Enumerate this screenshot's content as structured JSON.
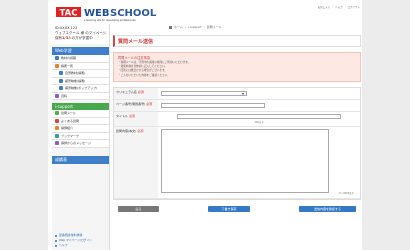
{
  "brand": {
    "school_name": "TAC",
    "product": "WEB SCHOOL",
    "tagline": "a learning site for developing professionals."
  },
  "header": {
    "links": [
      "お気に入り",
      "ヘルプ",
      "ログアウト"
    ]
  },
  "user": {
    "id": "ID:XXXX 122",
    "name": "ウェブスクール 様 のマイページ",
    "points_prefix": "保有",
    "points_value": "1/3",
    "points_suffix": "人の方が学習中"
  },
  "nav": {
    "webschool_head": "Web学習",
    "webschool_items": [
      {
        "label": "教材の視聴",
        "icon": "play-icon"
      },
      {
        "label": "講義一覧",
        "icon": "list-icon"
      },
      {
        "label": "自習教材(講義)",
        "icon": "book-icon"
      },
      {
        "label": "補習映像(講義)",
        "icon": "video-icon"
      },
      {
        "label": "補習映像(ポップアップ)",
        "icon": "popup-icon"
      },
      {
        "label": "資料",
        "icon": "document-icon"
      }
    ],
    "support_head": "i-support",
    "support_items": [
      {
        "label": "質問メール",
        "icon": "mail-icon"
      },
      {
        "label": "よくある質問",
        "icon": "question-icon"
      },
      {
        "label": "講師紹介",
        "icon": "teacher-icon"
      },
      {
        "label": "ブックマーク",
        "icon": "bookmark-icon"
      },
      {
        "label": "講師からのメッセージ",
        "icon": "message-icon"
      }
    ],
    "results_head": "成績表"
  },
  "footer_links": [
    "受講相談/無料体験",
    "Web マイページ/ログイン",
    "ヘルプ"
  ],
  "breadcrumb": [
    "ホーム",
    "i-support",
    "質問メール"
  ],
  "page_title": "質問メール送信",
  "notice": {
    "title": "質問メールの注意事項",
    "lines": [
      "・質問メールは、学習中の講座の質問にご利用いただけます。",
      "・質問内容を具体的に記入してください。",
      "・回答には数日かかる場合がございます。",
      "・ご入力いただいた内容をご確認ください。"
    ]
  },
  "form": {
    "course_label": "カリキュラム名",
    "course_required": "必須",
    "page_label": "ページ番号(問題番号)",
    "page_required": "必須",
    "title_label": "タイトル",
    "title_required": "必須",
    "title_hint": "400文字",
    "body_label": "質問内容(本文)",
    "body_required": "必須",
    "char_count": "0 / 2000文字"
  },
  "buttons": {
    "back": "戻る",
    "draft": "下書き保存",
    "confirm": "送信内容を確認する"
  }
}
